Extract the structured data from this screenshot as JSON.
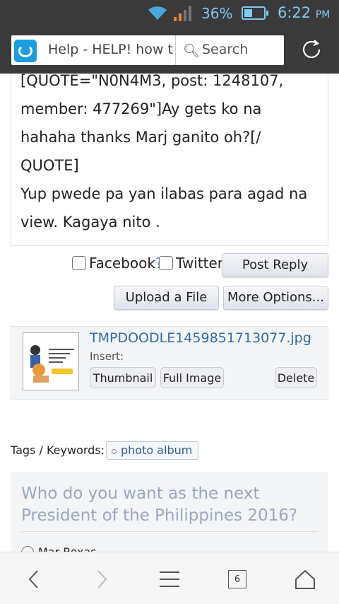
{
  "status": {
    "battery": "36%",
    "time": "6:22",
    "ampm": "PM"
  },
  "browser": {
    "url_text": "Help - HELP! how t",
    "search_label": "Search",
    "tab_count": "6"
  },
  "post": {
    "lines": [
      "[QUOTE=\"N0N4M3, post: 1248107,",
      "member: 477269\"]Ay gets ko na",
      "hahaha thanks Marj ganito oh?[/",
      "QUOTE]",
      "Yup pwede pa yan ilabas para agad na",
      "view. Kagaya nito ."
    ]
  },
  "reply": {
    "facebook_label": "Facebook",
    "facebook_q": "?",
    "twitter_label": "Twitter",
    "post_reply": "Post Reply",
    "upload": "Upload a File",
    "more_options": "More Options..."
  },
  "attachment": {
    "filename": "TMPDOODLE1459851713077.jpg",
    "insert_label": "Insert:",
    "thumbnail_btn": "Thumbnail",
    "full_image_btn": "Full Image",
    "delete_btn": "Delete"
  },
  "tags": {
    "label": "Tags / Keywords:",
    "chip": "photo album"
  },
  "poll": {
    "question": "Who do you want as the next President of the Philippines 2016?",
    "first_option": "Mar Roxas"
  }
}
